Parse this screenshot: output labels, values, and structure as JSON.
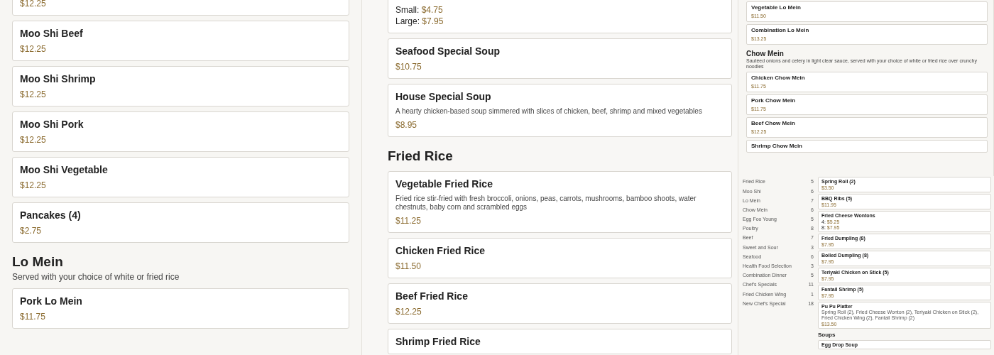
{
  "left_panel": {
    "blocks": [
      {
        "kind": "item",
        "prices": [
          {
            "value": "$12.25"
          }
        ]
      },
      {
        "kind": "item",
        "name": "Moo Shi Beef",
        "prices": [
          {
            "value": "$12.25"
          }
        ]
      },
      {
        "kind": "item",
        "name": "Moo Shi Shrimp",
        "prices": [
          {
            "value": "$12.25"
          }
        ]
      },
      {
        "kind": "item",
        "name": "Moo Shi Pork",
        "prices": [
          {
            "value": "$12.25"
          }
        ]
      },
      {
        "kind": "item",
        "name": "Moo Shi Vegetable",
        "prices": [
          {
            "value": "$12.25"
          }
        ]
      },
      {
        "kind": "item",
        "name": "Pancakes (4)",
        "prices": [
          {
            "value": "$2.75"
          }
        ]
      },
      {
        "kind": "section",
        "title": "Lo Mein",
        "description": "Served with your choice of white or fried rice"
      },
      {
        "kind": "item",
        "name": "Pork Lo Mein",
        "prices": [
          {
            "value": "$11.75"
          }
        ]
      }
    ]
  },
  "middle_panel": {
    "blocks": [
      {
        "kind": "item",
        "prices": [
          {
            "label": "Small:",
            "value": "$4.75"
          },
          {
            "label": "Large:",
            "value": "$7.95"
          }
        ]
      },
      {
        "kind": "item",
        "name": "Seafood Special Soup",
        "prices": [
          {
            "value": "$10.75"
          }
        ]
      },
      {
        "kind": "item",
        "name": "House Special Soup",
        "description": "A hearty chicken-based soup simmered with slices of chicken, beef, shrimp and mixed vegetables",
        "prices": [
          {
            "value": "$8.95"
          }
        ]
      },
      {
        "kind": "section",
        "title": "Fried Rice"
      },
      {
        "kind": "item",
        "name": "Vegetable Fried Rice",
        "description": "Fried rice stir-fried with fresh broccoli, onions, peas, carrots, mushrooms, bamboo shoots, water chestnuts, baby corn and scrambled eggs",
        "prices": [
          {
            "value": "$11.25"
          }
        ]
      },
      {
        "kind": "item",
        "name": "Chicken Fried Rice",
        "prices": [
          {
            "value": "$11.50"
          }
        ]
      },
      {
        "kind": "item",
        "name": "Beef Fried Rice",
        "prices": [
          {
            "value": "$12.25"
          }
        ]
      },
      {
        "kind": "item",
        "name": "Shrimp Fried Rice"
      }
    ]
  },
  "right_panel": {
    "top_blocks": [
      {
        "kind": "item",
        "name": "Vegetable Lo Mein",
        "prices": [
          {
            "value": "$11.50"
          }
        ]
      },
      {
        "kind": "item",
        "name": "Combination Lo Mein",
        "prices": [
          {
            "value": "$13.25"
          }
        ]
      },
      {
        "kind": "section",
        "title": "Chow Mein",
        "description": "Sautéed onions and celery in light clear sauce, served with your choice of white or fried rice over crunchy noodles"
      },
      {
        "kind": "item",
        "name": "Chicken Chow Mein",
        "prices": [
          {
            "value": "$11.75"
          }
        ]
      },
      {
        "kind": "item",
        "name": "Pork Chow Mein",
        "prices": [
          {
            "value": "$11.75"
          }
        ]
      },
      {
        "kind": "item",
        "name": "Beef Chow Mein",
        "prices": [
          {
            "value": "$12.25"
          }
        ]
      },
      {
        "kind": "item",
        "name": "Shrimp Chow Mein"
      }
    ],
    "categories": [
      {
        "name": "Fried Rice",
        "count": "5"
      },
      {
        "name": "Moo Shi",
        "count": "6"
      },
      {
        "name": "Lo Mein",
        "count": "7"
      },
      {
        "name": "Chow Mein",
        "count": "6"
      },
      {
        "name": "Egg Foo Young",
        "count": "5"
      },
      {
        "name": "Poultry",
        "count": "8"
      },
      {
        "name": "Beef",
        "count": "7"
      },
      {
        "name": "Sweet and Sour",
        "count": "3"
      },
      {
        "name": "Seafood",
        "count": "6"
      },
      {
        "name": "Health Food Selection",
        "count": "3"
      },
      {
        "name": "Combination Dinner",
        "count": "5"
      },
      {
        "name": "Chef's Specials",
        "count": "11"
      },
      {
        "name": "Fried Chicken Wing",
        "count": "1"
      },
      {
        "name": "New Chef's Special",
        "count": "18"
      }
    ],
    "blocks": [
      {
        "kind": "item",
        "name": "Spring Roll (2)",
        "prices": [
          {
            "value": "$3.50"
          }
        ]
      },
      {
        "kind": "item",
        "name": "BBQ Ribs (5)",
        "prices": [
          {
            "value": "$11.95"
          }
        ]
      },
      {
        "kind": "item",
        "name": "Fried Cheese Wontons",
        "prices": [
          {
            "label": "4:",
            "value": "$5.25"
          },
          {
            "label": "8:",
            "value": "$7.95"
          }
        ]
      },
      {
        "kind": "item",
        "name": "Fried Dumpling (8)",
        "prices": [
          {
            "value": "$7.95"
          }
        ]
      },
      {
        "kind": "item",
        "name": "Boiled Dumpling (8)",
        "prices": [
          {
            "value": "$7.95"
          }
        ]
      },
      {
        "kind": "item",
        "name": "Teriyaki Chicken on Stick (5)",
        "prices": [
          {
            "value": "$7.95"
          }
        ]
      },
      {
        "kind": "item",
        "name": "Fantail Shrimp (5)",
        "prices": [
          {
            "value": "$7.95"
          }
        ]
      },
      {
        "kind": "item",
        "name": "Pu Pu Platter",
        "description": "Spring Roll (2), Fried Cheese Wonton (2), Teriyaki Chicken on Stick (2), Fried Chicken Wing (2), Fantail Shrimp (2)",
        "prices": [
          {
            "value": "$13.50"
          }
        ]
      },
      {
        "kind": "section",
        "title": "Soups"
      },
      {
        "kind": "item",
        "name": "Egg Drop Soup"
      }
    ]
  }
}
